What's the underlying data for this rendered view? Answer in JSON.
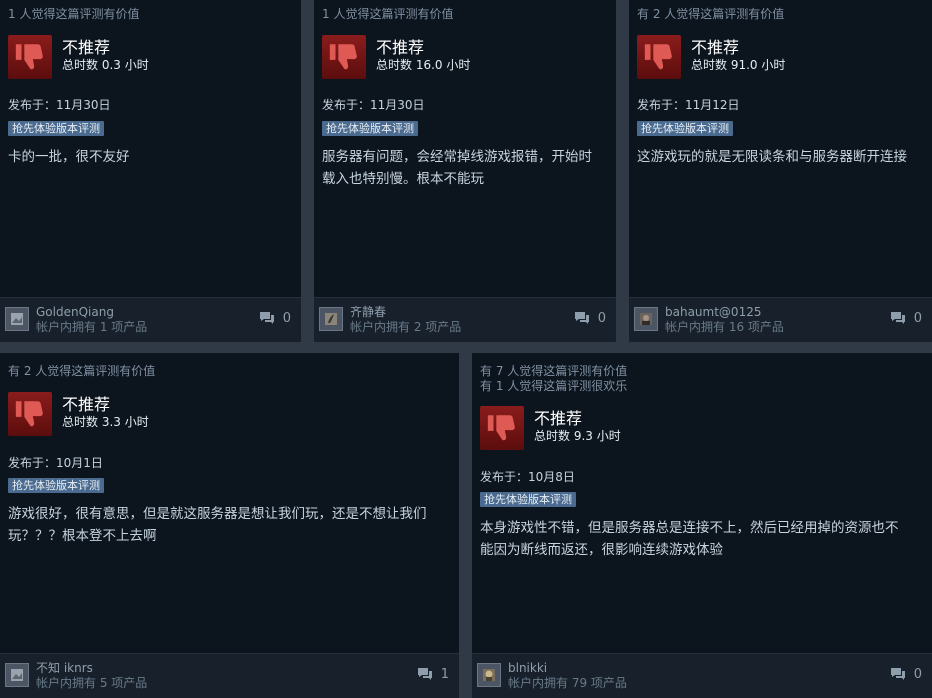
{
  "reviews": [
    {
      "helpful": [
        "1 人觉得这篇评测有价值"
      ],
      "verdict": "不推荐",
      "hours": "总时数 0.3 小时",
      "posted": "发布于：11月30日",
      "tag": "抢先体验版本评测",
      "content": [
        "卡的一批，很不友好"
      ],
      "author": "GoldenQiang",
      "owned": "帐户内拥有 1 项产品",
      "comments": "0"
    },
    {
      "helpful": [
        "1 人觉得这篇评测有价值"
      ],
      "verdict": "不推荐",
      "hours": "总时数 16.0 小时",
      "posted": "发布于：11月30日",
      "tag": "抢先体验版本评测",
      "content": [
        "服务器有问题，会经常掉线游戏报错，开始时",
        "载入也特别慢。根本不能玩"
      ],
      "author": "齐静春",
      "owned": "帐户内拥有 2 项产品",
      "comments": "0"
    },
    {
      "helpful": [
        "有 2 人觉得这篇评测有价值"
      ],
      "verdict": "不推荐",
      "hours": "总时数 91.0 小时",
      "posted": "发布于：11月12日",
      "tag": "抢先体验版本评测",
      "content": [
        "这游戏玩的就是无限读条和与服务器断开连接"
      ],
      "author": "bahaumt@0125",
      "owned": "帐户内拥有 16 项产品",
      "comments": "0"
    },
    {
      "helpful": [
        "有 2 人觉得这篇评测有价值"
      ],
      "verdict": "不推荐",
      "hours": "总时数 3.3 小时",
      "posted": "发布于：10月1日",
      "tag": "抢先体验版本评测",
      "content": [
        "游戏很好，很有意思，但是就这服务器是想让我们玩，还是不想让我们",
        "玩？？？根本登不上去啊"
      ],
      "author": "不知 iknrs",
      "owned": "帐户内拥有 5 项产品",
      "comments": "1"
    },
    {
      "helpful": [
        "有 7 人觉得这篇评测有价值",
        "有 1 人觉得这篇评测很欢乐"
      ],
      "verdict": "不推荐",
      "hours": "总时数 9.3 小时",
      "posted": "发布于：10月8日",
      "tag": "抢先体验版本评测",
      "content": [
        "本身游戏性不错，但是服务器总是连接不上，然后已经用掉的资源也不",
        "能因为断线而返还，很影响连续游戏体验"
      ],
      "author": "blnikki",
      "owned": "帐户内拥有 79 项产品",
      "comments": "0"
    }
  ]
}
